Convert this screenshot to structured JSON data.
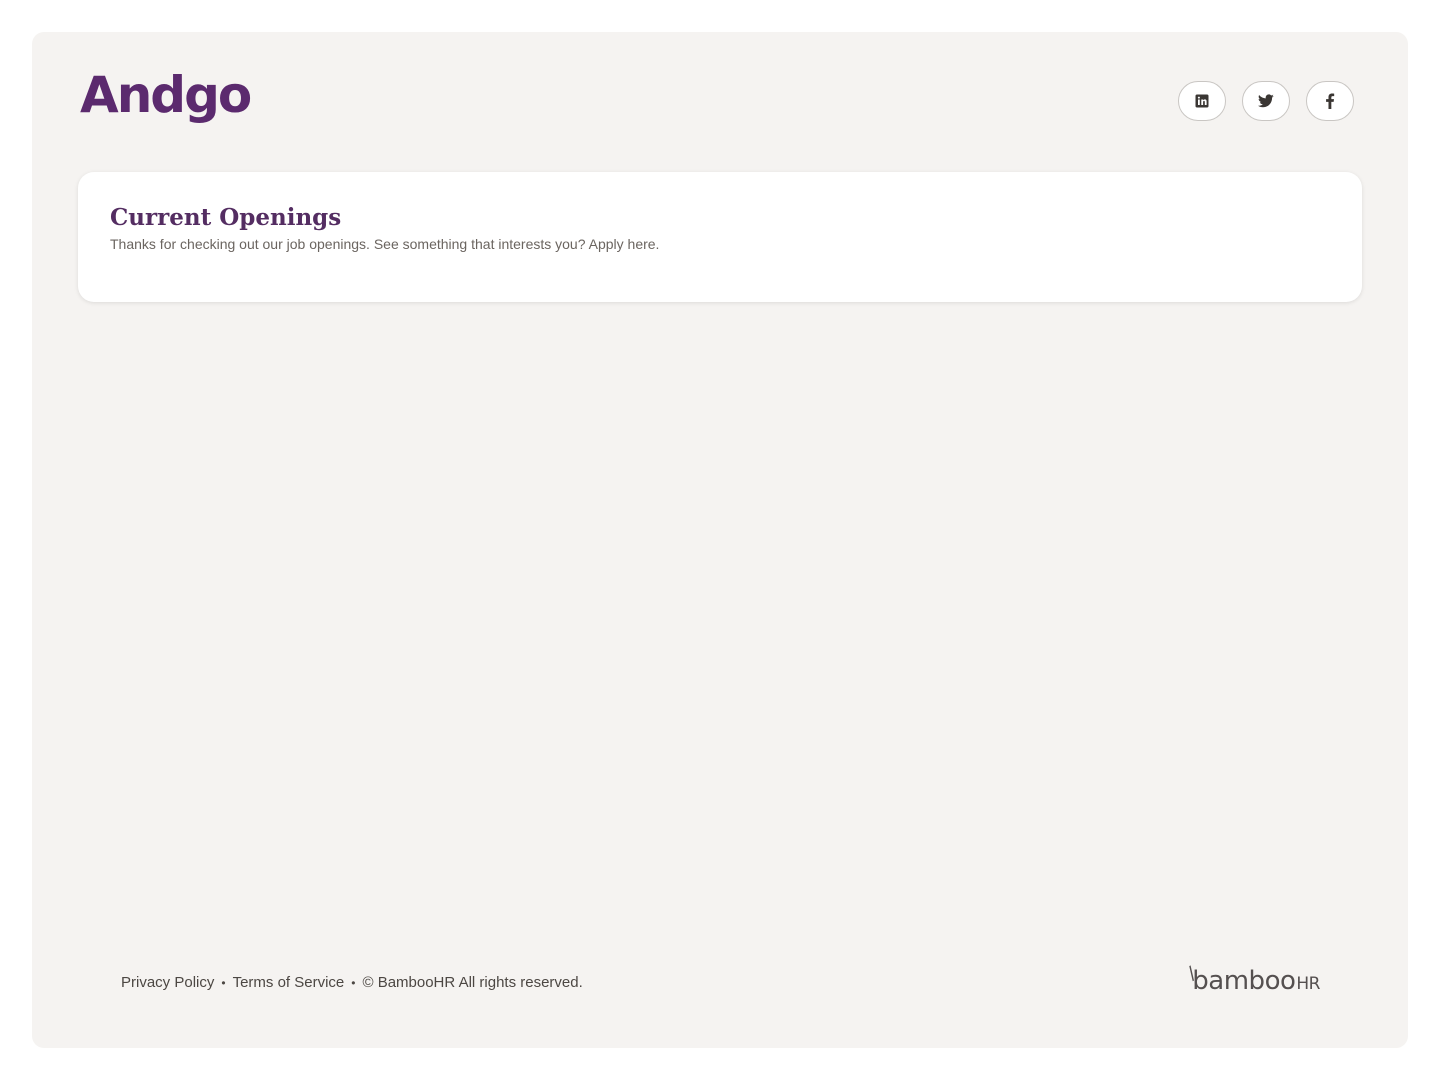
{
  "header": {
    "logo_text": "Andgo",
    "social": [
      {
        "name": "linkedin",
        "icon": "linkedin-icon"
      },
      {
        "name": "twitter",
        "icon": "twitter-icon"
      },
      {
        "name": "facebook",
        "icon": "facebook-icon"
      }
    ]
  },
  "openings": {
    "title": "Current Openings",
    "subtitle": "Thanks for checking out our job openings. See something that interests you? Apply here."
  },
  "footer": {
    "privacy_label": "Privacy Policy",
    "separator": "•",
    "terms_label": "Terms of Service",
    "copyright": "© BambooHR All rights reserved.",
    "powered_logo_main": "bamboo",
    "powered_logo_suffix": "HR"
  },
  "colors": {
    "brand_purple": "#5b2a6e",
    "background": "#f5f3f1",
    "card": "#ffffff"
  }
}
